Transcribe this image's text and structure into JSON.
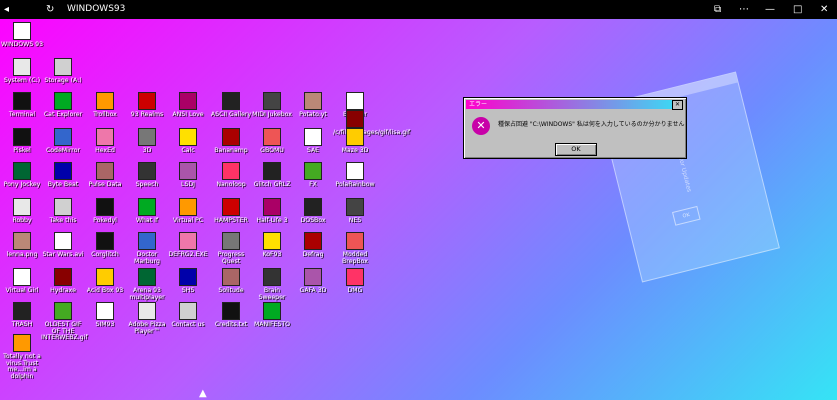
{
  "titlebar": {
    "title": "WINDOWS93",
    "minimize": "—",
    "close": "✕",
    "maximize": "□",
    "back": "◂",
    "refresh": "↻",
    "panel": "⧉",
    "more": "⋯"
  },
  "dialog": {
    "title": "エラー",
    "message": "種保占回避 \"C:\\WINDOWS\" 私は何を入力しているのか分かりません",
    "ok": "OK",
    "close": "✕"
  },
  "ghost": {
    "text": "Checking for Updates",
    "button": "OK"
  },
  "icons": [
    "WINDOWS 93",
    "System (C:)",
    "Storage (A:)",
    "Terminal",
    "Cat Explorer",
    "Trollbox",
    "93 Realms",
    "ANSI Love",
    "ASCII Gallery",
    "MIDI Jukebox",
    "Potato.yt",
    "Blogger",
    "Piskel",
    "CodeMirror",
    "HexEd",
    "3D",
    "Calc",
    "Bananamp",
    "GBOMU",
    "SAE",
    "/c/files/images/gif/lisa.gif",
    "Maze 3D",
    "Pony Jockey",
    "Byte Beat",
    "Pulse Data",
    "Speech",
    "LSDJ",
    "Nanoloop",
    "Glitch GRLZ",
    "FX",
    "PolaRainbow",
    "Robby",
    "Take this",
    "Pokedyl",
    "What If",
    "Virtual PC",
    "HAMPSTER",
    "Half-Life 3",
    "DOSBox",
    "NES",
    "lenna.png",
    "Star Wars.avi",
    "Corglitch",
    "Doctor Marburg",
    "DEFRG2.EXE",
    "Progress Quest",
    "KoF93",
    "Defrag",
    "Modded BrepBox",
    "Virtual Girl",
    "Hydraxe",
    "Acid Box 93",
    "Arena 93 multiplayer",
    "SHS",
    "Solitude",
    "Brain Sweeper",
    "GAFA 3D",
    "DMG",
    "TRASH",
    "OLDEST GIF OF THE INTERWEBZ.gif",
    "SIM93",
    "Adobe Pizza Player™",
    "Contact us",
    "Credits.txt",
    "MANIFESTO",
    "Totally not a virus.Trust me...im a dolphin"
  ]
}
